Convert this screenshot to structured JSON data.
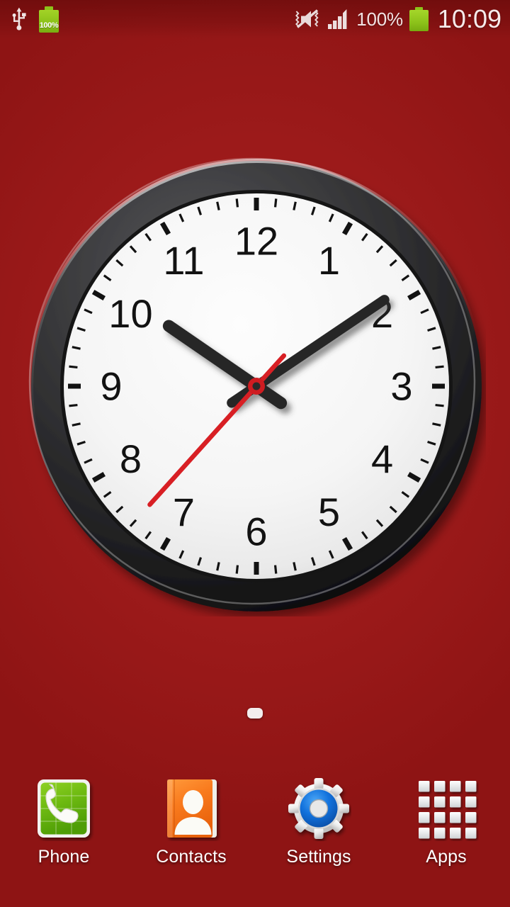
{
  "status_bar": {
    "usb_icon": "usb-icon",
    "battery_left": {
      "icon": "battery-icon",
      "percent_label": "100%"
    },
    "mute_icon": "vibrate-mute-icon",
    "signal_icon": "signal-bars-icon",
    "battery_percent": "100%",
    "battery_right_icon": "battery-icon",
    "time": "10:09"
  },
  "clock_widget": {
    "name": "analog-clock-widget",
    "numerals": [
      "12",
      "1",
      "2",
      "3",
      "4",
      "5",
      "6",
      "7",
      "8",
      "9",
      "10",
      "11"
    ],
    "hands": {
      "hour": {
        "value": 10,
        "angle_deg": 304.5
      },
      "minute": {
        "value": 9,
        "angle_deg": 56
      },
      "second": {
        "value": 37,
        "angle_deg": 222
      }
    },
    "displayed_time": "10:09:37",
    "colors": {
      "bezel": "#2f2f2f",
      "face": "#f4f4f4",
      "numerals": "#121212",
      "hour_hand": "#262626",
      "minute_hand": "#262626",
      "second_hand": "#d81f24",
      "hub": "#cf1c21"
    }
  },
  "page_indicator": {
    "name": "page-indicator",
    "pages": 1,
    "current": 1
  },
  "dock": {
    "items": [
      {
        "label": "Phone",
        "icon": "phone-icon",
        "name": "dock-item-phone"
      },
      {
        "label": "Contacts",
        "icon": "contacts-icon",
        "name": "dock-item-contacts"
      },
      {
        "label": "Settings",
        "icon": "settings-gear-icon",
        "name": "dock-item-settings"
      },
      {
        "label": "Apps",
        "icon": "apps-grid-icon",
        "name": "dock-item-apps"
      }
    ]
  },
  "wallpaper": {
    "color_center": "#a82222",
    "color_edge": "#8e1414"
  }
}
